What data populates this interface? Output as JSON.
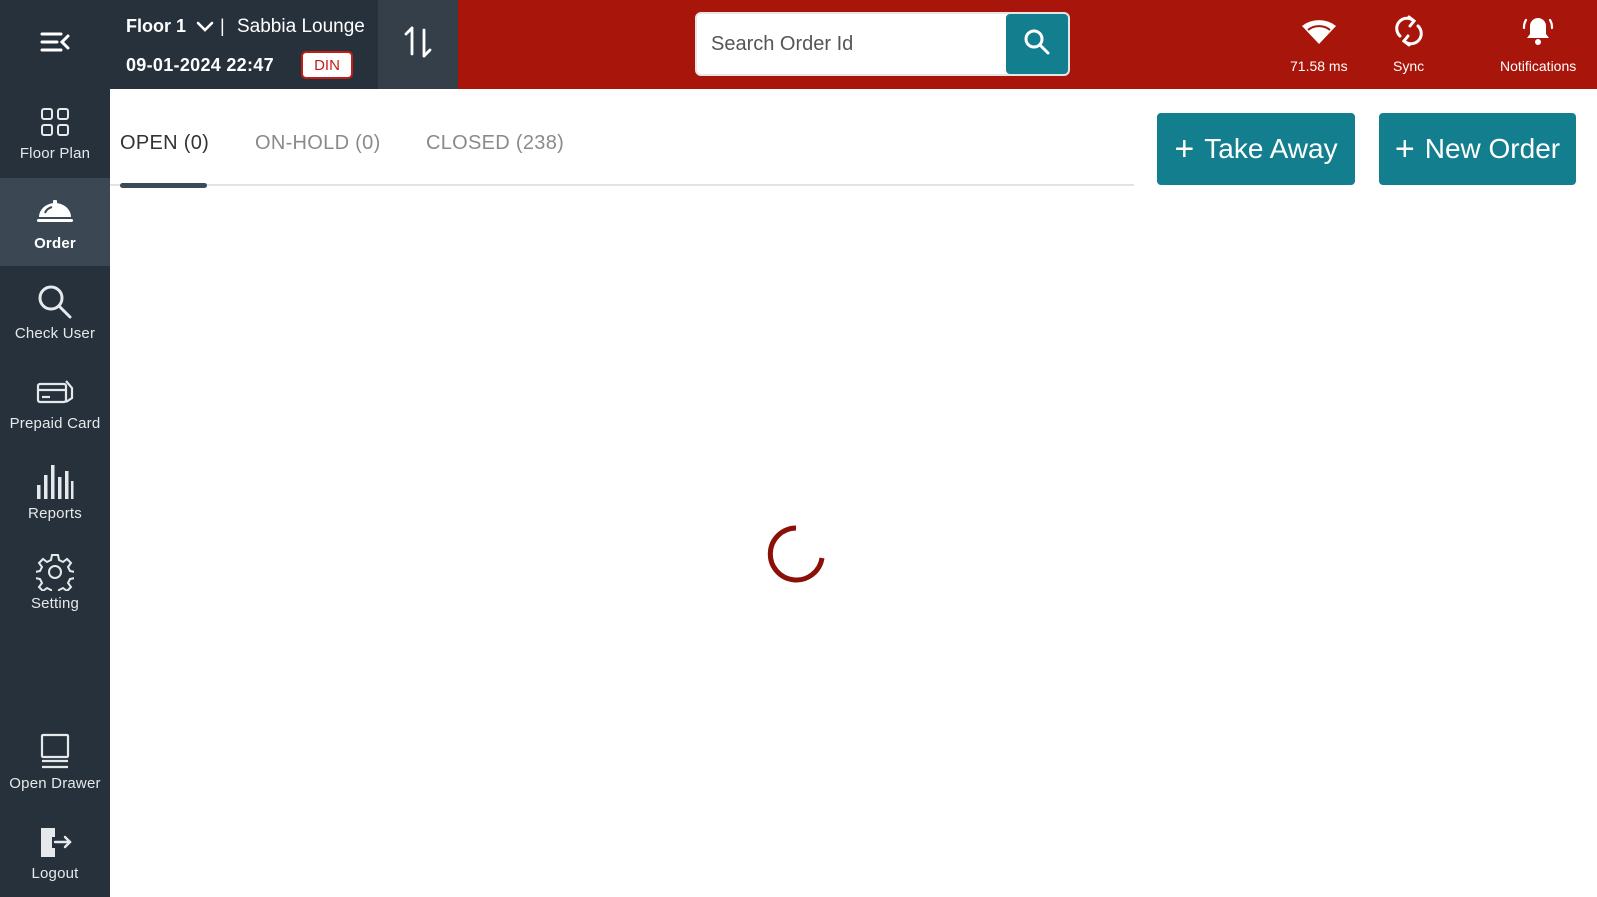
{
  "sidebar": {
    "menu_icon": "menu-collapse-icon",
    "items": [
      {
        "label": "Floor Plan",
        "icon": "grid-icon",
        "active": false
      },
      {
        "label": "Order",
        "icon": "cloche-icon",
        "active": true
      },
      {
        "label": "Check User",
        "icon": "search-icon",
        "active": false
      },
      {
        "label": "Prepaid Card",
        "icon": "card-icon",
        "active": false
      },
      {
        "label": "Reports",
        "icon": "bar-chart-icon",
        "active": false
      },
      {
        "label": "Setting",
        "icon": "gear-icon",
        "active": false
      },
      {
        "label": "Open Drawer",
        "icon": "cash-drawer-icon",
        "active": false
      },
      {
        "label": "Logout",
        "icon": "logout-icon",
        "active": false
      }
    ]
  },
  "header": {
    "floor": "Floor 1",
    "separator": "|",
    "outlet": "Sabbia Lounge",
    "datetime": "09-01-2024 22:47",
    "mode_badge": "DIN",
    "search_placeholder": "Search Order Id",
    "latency": "71.58 ms",
    "sync_label": "Sync",
    "notifications_label": "Notifications"
  },
  "tabs": [
    {
      "label": "OPEN (0)",
      "active": true
    },
    {
      "label": "ON-HOLD (0)",
      "active": false
    },
    {
      "label": "CLOSED (238)",
      "active": false
    }
  ],
  "actions": {
    "take_away": "Take Away",
    "new_order": "New Order",
    "plus": "+"
  },
  "colors": {
    "header_red": "#a8150a",
    "sidebar_dark": "#26313b",
    "accent_teal": "#137f8e",
    "spinner": "#8b1008"
  }
}
